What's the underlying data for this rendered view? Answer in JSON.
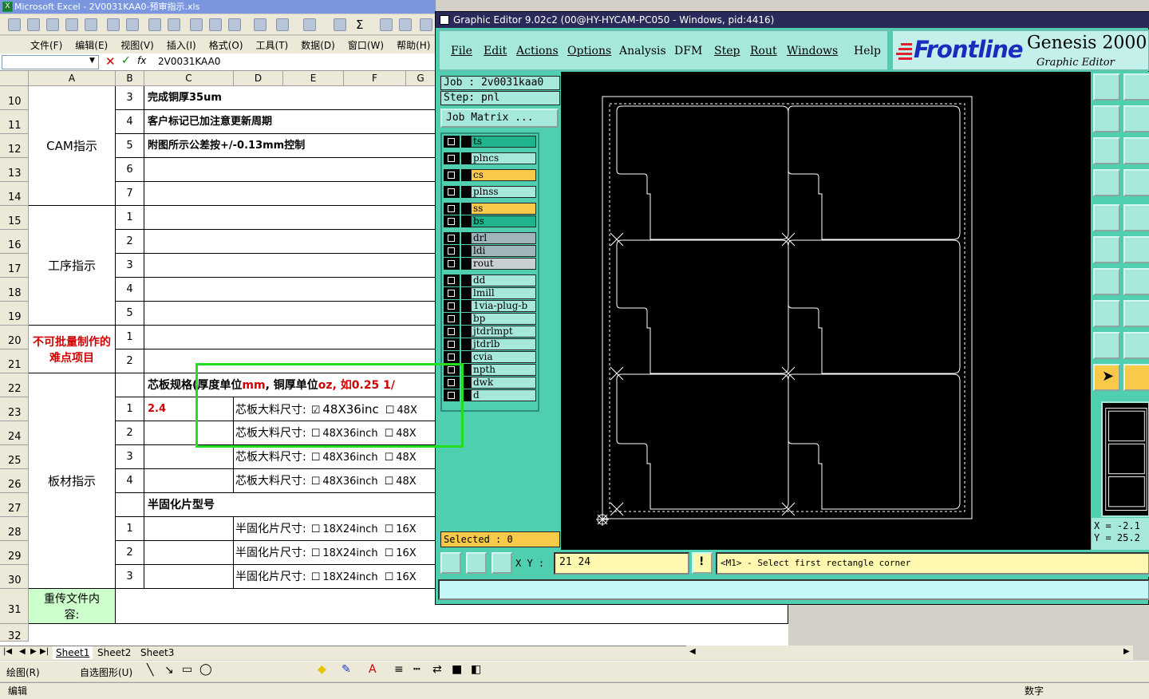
{
  "excel": {
    "title": "Microsoft Excel - 2V0031KAA0-预审指示.xls",
    "menu": [
      "文件(F)",
      "编辑(E)",
      "视图(V)",
      "插入(I)",
      "格式(O)",
      "工具(T)",
      "数据(D)",
      "窗口(W)",
      "帮助(H)"
    ],
    "name_box": "",
    "fx": "fx",
    "formula_value": "2V0031KAA0",
    "columns": [
      "A",
      "B",
      "C",
      "D",
      "E",
      "F",
      "G"
    ],
    "rows": [
      "10",
      "11",
      "12",
      "13",
      "14",
      "15",
      "16",
      "17",
      "18",
      "19",
      "20",
      "21",
      "22",
      "23",
      "24",
      "25",
      "26",
      "27",
      "28",
      "29",
      "30",
      "31",
      "32"
    ],
    "groups": {
      "cam": "CAM指示",
      "process": "工序指示",
      "difficult": "不可批量制作的难点项目",
      "board": "板材指示",
      "resend": "重传文件内容:"
    },
    "cells": {
      "r10b": "3",
      "r10c": "完成铜厚35um",
      "r11b": "4",
      "r11c": "客户标记已加注意更新周期",
      "r12b": "5",
      "r12c": "附图所示公差按+/-0.13mm控制",
      "r13b": "6",
      "r14b": "7",
      "r15b": "1",
      "r16b": "2",
      "r17b": "3",
      "r18b": "4",
      "r19b": "5",
      "r20b": "1",
      "r21b": "2",
      "r22c_a": "芯板规格(厚度单位",
      "r22c_b": "mm",
      "r22c_c": ", 铜厚单位",
      "r22c_d": "oz, 如0.25 1/",
      "r23b": "1",
      "r23c": "2.4",
      "r23d": "芯板大料尺寸:",
      "r23e": "48X36inc",
      "r23f": "48X",
      "r24b": "2",
      "r24d": "芯板大料尺寸:",
      "r24e": "48X36inch",
      "r24f": "48X",
      "r25b": "3",
      "r25d": "芯板大料尺寸:",
      "r25e": "48X36inch",
      "r25f": "48X",
      "r26b": "4",
      "r26d": "芯板大料尺寸:",
      "r26e": "48X36inch",
      "r26f": "48X",
      "r27c": "半固化片型号",
      "r28b": "1",
      "r28d": "半固化片尺寸:",
      "r28e": "18X24inch",
      "r28f": "16X",
      "r29b": "2",
      "r29d": "半固化片尺寸:",
      "r29e": "18X24inch",
      "r29f": "16X",
      "r30b": "3",
      "r30d": "半固化片尺寸:",
      "r30e": "18X24inch",
      "r30f": "16X"
    },
    "sheets": [
      "Sheet1",
      "Sheet2",
      "Sheet3"
    ],
    "draw_toolbar": {
      "draw": "绘图(R)",
      "autoshape": "自选图形(U)"
    },
    "status_left": "编辑",
    "status_right": "数字"
  },
  "genesis": {
    "title": "Graphic Editor 9.02c2 (00@HY-HYCAM-PC050 - Windows, pid:4416)",
    "menu": [
      "File",
      "Edit",
      "Actions",
      "Options",
      "Analysis",
      "DFM",
      "Step",
      "Rout",
      "Windows",
      "Help"
    ],
    "logo": {
      "brand": "Frontline",
      "product": "Genesis 2000",
      "suffix": "2",
      "subtitle": "Graphic Editor"
    },
    "job": "Job : 2v0031kaa0",
    "step": "Step: pnl",
    "job_matrix": "Job Matrix ...",
    "layers": [
      {
        "name": "ts",
        "color": "#1fb38e"
      },
      {
        "name": "plncs",
        "color": "#a7e8dc"
      },
      {
        "name": "cs",
        "color": "#f9c94a"
      },
      {
        "name": "plnss",
        "color": "#a7e8dc"
      },
      {
        "name": "ss",
        "color": "#f9c94a"
      },
      {
        "name": "bs",
        "color": "#1fb38e"
      },
      {
        "name": "drl",
        "color": "#a0b4bc"
      },
      {
        "name": "ldi",
        "color": "#a0b4bc"
      },
      {
        "name": "rout",
        "color": "#c8d0d4"
      },
      {
        "name": "dd",
        "color": "#a7e8dc"
      },
      {
        "name": "lmill",
        "color": "#a7e8dc"
      },
      {
        "name": "1via-plug-b",
        "color": "#a7e8dc"
      },
      {
        "name": "bp",
        "color": "#a7e8dc"
      },
      {
        "name": "jtdrlmpt",
        "color": "#a7e8dc"
      },
      {
        "name": "jtdrlb",
        "color": "#a7e8dc"
      },
      {
        "name": "cvia",
        "color": "#a7e8dc"
      },
      {
        "name": "npth",
        "color": "#a7e8dc"
      },
      {
        "name": "dwk",
        "color": "#a7e8dc"
      },
      {
        "name": "d",
        "color": "#a7e8dc"
      }
    ],
    "selected": "Selected : 0",
    "xy_label": "X Y :",
    "xy_value": "21 24",
    "message": "<M1> - Select first rectangle corner",
    "coords": {
      "x": "X  =  -2.1",
      "y": "Y  =  25.2"
    }
  }
}
